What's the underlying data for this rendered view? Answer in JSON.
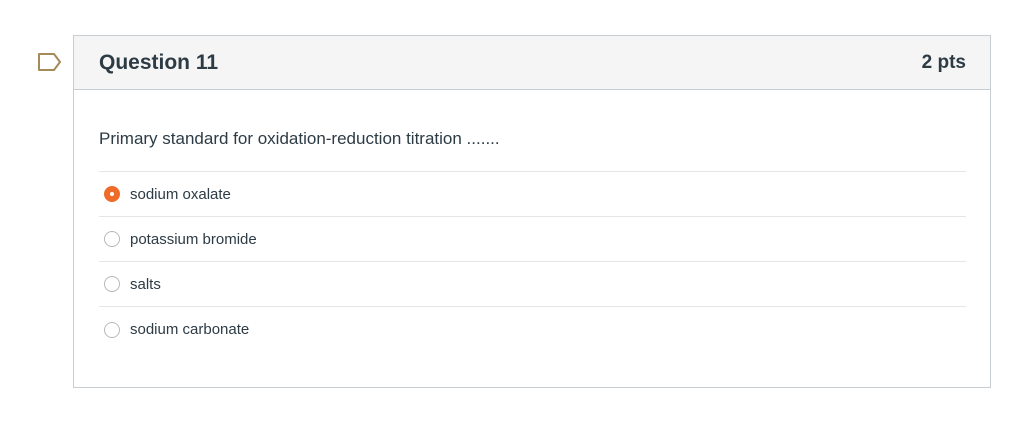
{
  "flag": {
    "icon": "bookmark-flag-icon"
  },
  "question": {
    "title": "Question 11",
    "points": "2 pts",
    "text": "Primary standard for oxidation-reduction titration .......",
    "answers": [
      {
        "label": "sodium oxalate",
        "selected": true
      },
      {
        "label": "potassium bromide",
        "selected": false
      },
      {
        "label": "salts",
        "selected": false
      },
      {
        "label": "sodium carbonate",
        "selected": false
      }
    ]
  },
  "colors": {
    "selected_radio": "#ee6b2a",
    "header_background": "#f5f5f5",
    "border": "#c7cdd1",
    "text": "#2d3b45"
  }
}
